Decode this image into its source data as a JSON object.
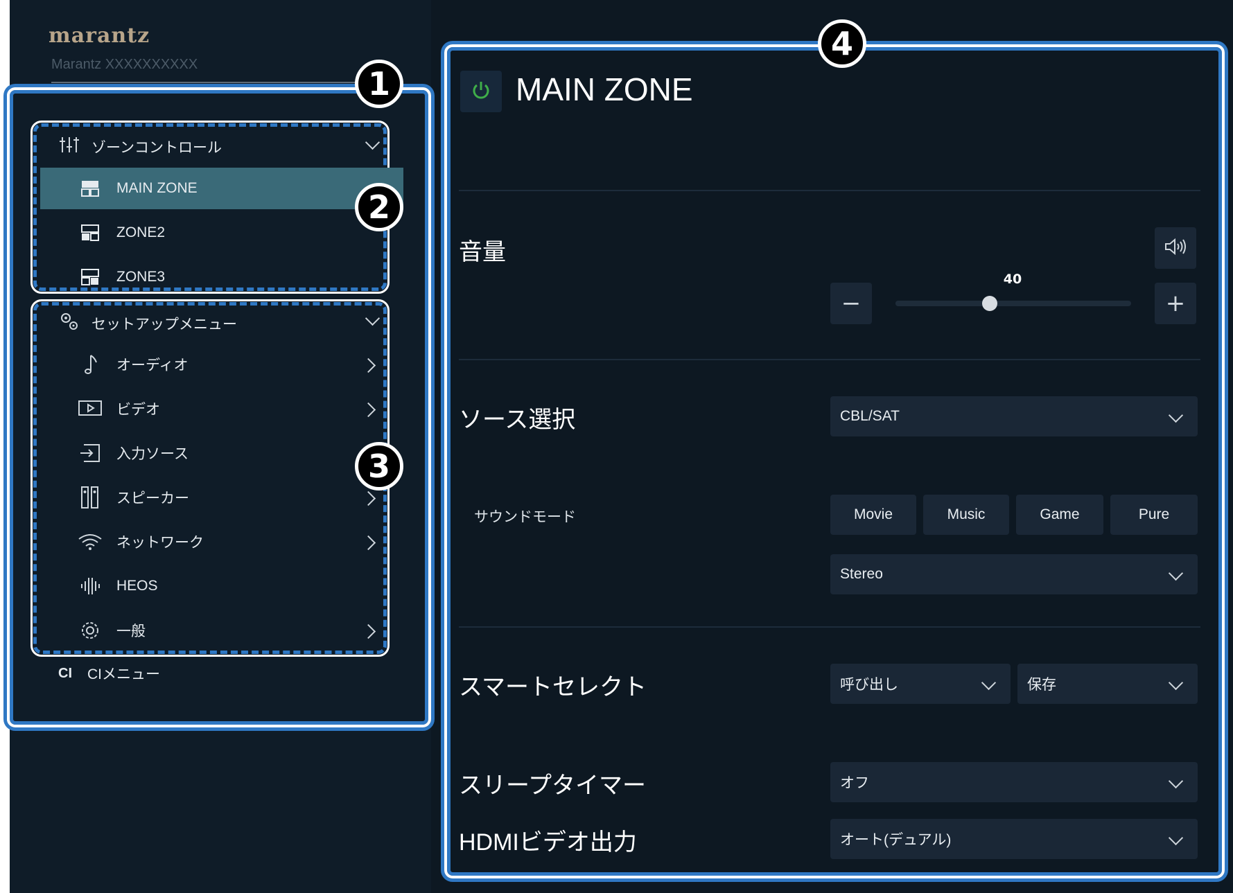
{
  "brand": {
    "logo": "marantz",
    "device_name": "Marantz XXXXXXXXXX"
  },
  "callouts": [
    "1",
    "2",
    "3",
    "4"
  ],
  "zone_control": {
    "title": "ゾーンコントロール",
    "items": [
      {
        "label": "MAIN ZONE",
        "active": true
      },
      {
        "label": "ZONE2",
        "active": false
      },
      {
        "label": "ZONE3",
        "active": false
      }
    ]
  },
  "setup_menu": {
    "title": "セットアップメニュー",
    "items": [
      {
        "label": "オーディオ",
        "icon": "music-note-icon"
      },
      {
        "label": "ビデオ",
        "icon": "video-icon"
      },
      {
        "label": "入力ソース",
        "icon": "input-source-icon"
      },
      {
        "label": "スピーカー",
        "icon": "speaker-icon"
      },
      {
        "label": "ネットワーク",
        "icon": "wifi-icon"
      },
      {
        "label": "HEOS",
        "icon": "heos-icon"
      },
      {
        "label": "一般",
        "icon": "gear-icon"
      }
    ]
  },
  "ci_menu": {
    "icon_text": "CI",
    "label": "CIメニュー"
  },
  "main": {
    "title": "MAIN ZONE",
    "volume": {
      "label": "音量",
      "value": "40",
      "level": 0.4,
      "minus": "−",
      "plus": "+"
    },
    "source": {
      "label": "ソース選択",
      "value": "CBL/SAT"
    },
    "sound_mode": {
      "label": "サウンドモード",
      "buttons": [
        "Movie",
        "Music",
        "Game",
        "Pure"
      ],
      "value": "Stereo"
    },
    "smart_select": {
      "label": "スマートセレクト",
      "recall": "呼び出し",
      "save": "保存"
    },
    "sleep_timer": {
      "label": "スリープタイマー",
      "value": "オフ"
    },
    "hdmi_out": {
      "label": "HDMIビデオ出力",
      "value": "オート(デュアル)"
    }
  },
  "colors": {
    "accent": "#2f78c4",
    "active_item": "#3a6a78",
    "power_green": "#3fae49"
  }
}
